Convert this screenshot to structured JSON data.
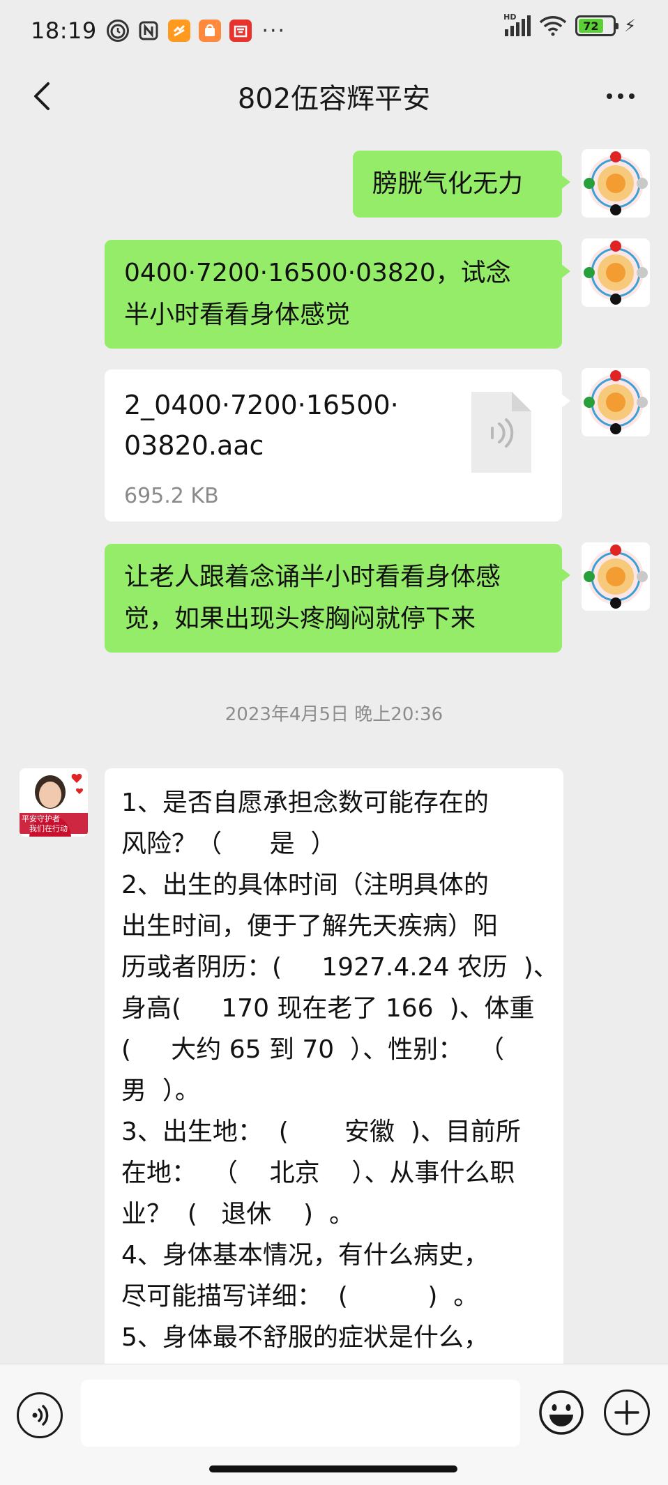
{
  "status_bar": {
    "time": "18:19",
    "left_icons": [
      "alarm-clock-icon",
      "nfc-icon",
      "taobao-icon",
      "shopping-bag-icon",
      "store-icon"
    ],
    "more_notifications": "···",
    "network": "HD",
    "battery_level": "72",
    "charging": true
  },
  "header": {
    "title": "802伍容辉平安",
    "back_icon": "chevron-left-icon",
    "more_icon": "more-dots-icon"
  },
  "messages": [
    {
      "sender": "me",
      "type": "text",
      "text": "膀胱气化无力"
    },
    {
      "sender": "me",
      "type": "text",
      "lines": [
        "0400·7200·16500·03820，试念",
        "半小时看看身体感觉"
      ]
    },
    {
      "sender": "me",
      "type": "file",
      "file_name_lines": [
        "2_0400·7200·16500·",
        "03820.aac"
      ],
      "file_size": "695.2 KB",
      "file_icon": "audio-file-icon"
    },
    {
      "sender": "me",
      "type": "text",
      "lines": [
        "让老人跟着念诵半小时看看身体感",
        "觉，如果出现头疼胸闷就停下来"
      ]
    }
  ],
  "timestamp": "2023年4月5日 晚上20:36",
  "incoming": {
    "avatar_caption": [
      "平安守护者",
      "我们在行动"
    ],
    "lines": [
      "1、是否自愿承担念数可能存在的",
      "风险？（      是  ）",
      "2、出生的具体时间（注明具体的",
      "出生时间，便于了解先天疾病）阳",
      "历或者阴历：(     1927.4.24 农历  )、",
      "身高(     170 现在老了 166  )、体重",
      "(     大约 65 到 70  ）、性别：  （",
      "男  ）。",
      "3、出生地：  (       安徽  )、目前所",
      "在地：  （    北京    ）、从事什么职",
      "业？  (   退休    )  。",
      "4、身体基本情况，有什么病史，",
      "尽可能描写详细：  (          )  。",
      "5、身体最不舒服的症状是什么，"
    ]
  },
  "input_bar": {
    "voice_icon": "voice-input-icon",
    "input_value": "",
    "emoji_icon": "emoji-icon",
    "plus_icon": "plus-icon"
  },
  "colors": {
    "background": "#ededed",
    "my_bubble": "#95ec69",
    "other_bubble": "#ffffff",
    "timestamp": "#8c8c8c"
  }
}
